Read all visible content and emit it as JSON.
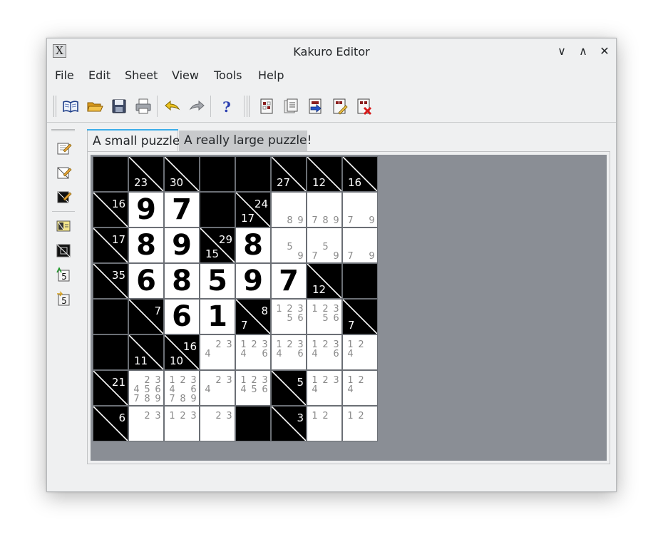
{
  "window": {
    "title": "Kakuro Editor",
    "app_icon_glyph": "X",
    "controls": [
      {
        "name": "minimize-button",
        "glyph": "∨"
      },
      {
        "name": "maximize-button",
        "glyph": "∧"
      },
      {
        "name": "close-button",
        "glyph": "✕"
      }
    ]
  },
  "menubar": [
    "File",
    "Edit",
    "Sheet",
    "View",
    "Tools",
    "Help"
  ],
  "toolbar": {
    "icons": [
      "book-icon",
      "open-folder-icon",
      "save-disk-icon",
      "print-icon",
      "undo-arrow-icon",
      "redo-arrow-icon",
      "help-question-icon",
      "sheet-new-icon",
      "sheet-copy-icon",
      "sheet-export-icon",
      "sheet-edit-icon",
      "sheet-delete-icon"
    ]
  },
  "left_toolbar": {
    "icons": [
      "edit-cell-icon",
      "edit-cell-alt-icon",
      "black-cell-icon",
      "clue-cell-icon",
      "solve-cell-icon",
      "number-5-icon",
      "number-5-alt-icon"
    ]
  },
  "tabs": [
    {
      "label": "A small puzzle",
      "active": true
    },
    {
      "label": "A really large puzzle!",
      "active": false
    }
  ],
  "colors": {
    "accent": "#3daee9",
    "window_bg": "#eff0f1",
    "canvas_bg": "#8a8e95",
    "pencil_gray": "#8a8a8a"
  },
  "puzzle": {
    "rows": 8,
    "cols": 8,
    "cells": [
      [
        {
          "t": "b"
        },
        {
          "t": "c",
          "down": "23"
        },
        {
          "t": "c",
          "down": "30"
        },
        {
          "t": "b"
        },
        {
          "t": "b"
        },
        {
          "t": "c",
          "down": "27"
        },
        {
          "t": "c",
          "down": "12"
        },
        {
          "t": "c",
          "down": "16"
        }
      ],
      [
        {
          "t": "c",
          "right": "16"
        },
        {
          "t": "v",
          "v": "9"
        },
        {
          "t": "v",
          "v": "7"
        },
        {
          "t": "b"
        },
        {
          "t": "c",
          "right": "24",
          "down": "17"
        },
        {
          "t": "p",
          "p": [
            "",
            "",
            "",
            "",
            "",
            "",
            "",
            "8",
            "9"
          ]
        },
        {
          "t": "p",
          "p": [
            "",
            "",
            "",
            "",
            "",
            "",
            "7",
            "8",
            "9"
          ]
        },
        {
          "t": "p",
          "p": [
            "",
            "",
            "",
            "",
            "",
            "",
            "7",
            "",
            "9"
          ]
        }
      ],
      [
        {
          "t": "c",
          "right": "17"
        },
        {
          "t": "v",
          "v": "8"
        },
        {
          "t": "v",
          "v": "9"
        },
        {
          "t": "c",
          "right": "29",
          "down": "15"
        },
        {
          "t": "v",
          "v": "8"
        },
        {
          "t": "p",
          "p": [
            "",
            "",
            "",
            "",
            "5",
            "",
            "",
            "",
            "9"
          ]
        },
        {
          "t": "p",
          "p": [
            "",
            "",
            "",
            "",
            "5",
            "",
            "7",
            "",
            "9"
          ]
        },
        {
          "t": "p",
          "p": [
            "",
            "",
            "",
            "",
            "",
            "",
            "7",
            "",
            "9"
          ]
        }
      ],
      [
        {
          "t": "c",
          "right": "35"
        },
        {
          "t": "v",
          "v": "6"
        },
        {
          "t": "v",
          "v": "8"
        },
        {
          "t": "v",
          "v": "5"
        },
        {
          "t": "v",
          "v": "9"
        },
        {
          "t": "v",
          "v": "7"
        },
        {
          "t": "c",
          "down": "12"
        },
        {
          "t": "b"
        }
      ],
      [
        {
          "t": "b"
        },
        {
          "t": "c",
          "right": "7"
        },
        {
          "t": "v",
          "v": "6"
        },
        {
          "t": "v",
          "v": "1"
        },
        {
          "t": "c",
          "right": "8",
          "down": "7"
        },
        {
          "t": "p",
          "p": [
            "1",
            "2",
            "3",
            "",
            "5",
            "6",
            "",
            "",
            ""
          ]
        },
        {
          "t": "p",
          "p": [
            "1",
            "2",
            "3",
            "",
            "5",
            "6",
            "",
            "",
            ""
          ]
        },
        {
          "t": "c",
          "down": "7"
        }
      ],
      [
        {
          "t": "b"
        },
        {
          "t": "c",
          "down": "11"
        },
        {
          "t": "c",
          "right": "16",
          "down": "10"
        },
        {
          "t": "p",
          "p": [
            "",
            "2",
            "3",
            "4",
            "",
            "",
            "",
            "",
            ""
          ]
        },
        {
          "t": "p",
          "p": [
            "1",
            "2",
            "3",
            "4",
            "",
            "6",
            "",
            "",
            ""
          ]
        },
        {
          "t": "p",
          "p": [
            "1",
            "2",
            "3",
            "4",
            "",
            "6",
            "",
            "",
            ""
          ]
        },
        {
          "t": "p",
          "p": [
            "1",
            "2",
            "3",
            "4",
            "",
            "6",
            "",
            "",
            ""
          ]
        },
        {
          "t": "p",
          "p": [
            "1",
            "2",
            "",
            "4",
            "",
            "",
            "",
            "",
            ""
          ]
        }
      ],
      [
        {
          "t": "c",
          "right": "21"
        },
        {
          "t": "p",
          "p": [
            "",
            "2",
            "3",
            "4",
            "5",
            "6",
            "7",
            "8",
            "9"
          ]
        },
        {
          "t": "p",
          "p": [
            "1",
            "2",
            "3",
            "4",
            "",
            "6",
            "7",
            "8",
            "9"
          ]
        },
        {
          "t": "p",
          "p": [
            "",
            "2",
            "3",
            "4",
            "",
            "",
            "",
            "",
            ""
          ]
        },
        {
          "t": "p",
          "p": [
            "1",
            "2",
            "3",
            "4",
            "5",
            "6",
            "",
            "",
            ""
          ]
        },
        {
          "t": "c",
          "right": "5"
        },
        {
          "t": "p",
          "p": [
            "1",
            "2",
            "3",
            "4",
            "",
            "",
            "",
            "",
            ""
          ]
        },
        {
          "t": "p",
          "p": [
            "1",
            "2",
            "",
            "4",
            "",
            "",
            "",
            "",
            ""
          ]
        }
      ],
      [
        {
          "t": "c",
          "right": "6"
        },
        {
          "t": "p",
          "p": [
            "",
            "2",
            "3",
            "",
            "",
            "",
            "",
            "",
            ""
          ]
        },
        {
          "t": "p",
          "p": [
            "1",
            "2",
            "3",
            "",
            "",
            "",
            "",
            "",
            ""
          ]
        },
        {
          "t": "p",
          "p": [
            "",
            "2",
            "3",
            "",
            "",
            "",
            "",
            "",
            ""
          ]
        },
        {
          "t": "b"
        },
        {
          "t": "c",
          "right": "3"
        },
        {
          "t": "p",
          "p": [
            "1",
            "2",
            "",
            "",
            "",
            "",
            "",
            "",
            ""
          ]
        },
        {
          "t": "p",
          "p": [
            "1",
            "2",
            "",
            "",
            "",
            "",
            "",
            "",
            ""
          ]
        }
      ]
    ]
  }
}
